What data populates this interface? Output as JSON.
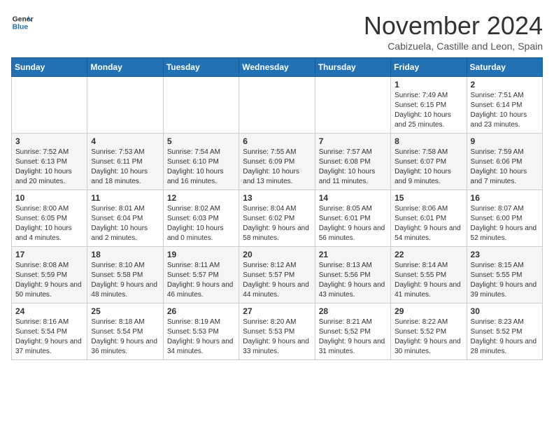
{
  "logo": {
    "general": "General",
    "blue": "Blue"
  },
  "header": {
    "month": "November 2024",
    "location": "Cabizuela, Castille and Leon, Spain"
  },
  "weekdays": [
    "Sunday",
    "Monday",
    "Tuesday",
    "Wednesday",
    "Thursday",
    "Friday",
    "Saturday"
  ],
  "weeks": [
    [
      {
        "day": "",
        "info": ""
      },
      {
        "day": "",
        "info": ""
      },
      {
        "day": "",
        "info": ""
      },
      {
        "day": "",
        "info": ""
      },
      {
        "day": "",
        "info": ""
      },
      {
        "day": "1",
        "info": "Sunrise: 7:49 AM\nSunset: 6:15 PM\nDaylight: 10 hours and 25 minutes."
      },
      {
        "day": "2",
        "info": "Sunrise: 7:51 AM\nSunset: 6:14 PM\nDaylight: 10 hours and 23 minutes."
      }
    ],
    [
      {
        "day": "3",
        "info": "Sunrise: 7:52 AM\nSunset: 6:13 PM\nDaylight: 10 hours and 20 minutes."
      },
      {
        "day": "4",
        "info": "Sunrise: 7:53 AM\nSunset: 6:11 PM\nDaylight: 10 hours and 18 minutes."
      },
      {
        "day": "5",
        "info": "Sunrise: 7:54 AM\nSunset: 6:10 PM\nDaylight: 10 hours and 16 minutes."
      },
      {
        "day": "6",
        "info": "Sunrise: 7:55 AM\nSunset: 6:09 PM\nDaylight: 10 hours and 13 minutes."
      },
      {
        "day": "7",
        "info": "Sunrise: 7:57 AM\nSunset: 6:08 PM\nDaylight: 10 hours and 11 minutes."
      },
      {
        "day": "8",
        "info": "Sunrise: 7:58 AM\nSunset: 6:07 PM\nDaylight: 10 hours and 9 minutes."
      },
      {
        "day": "9",
        "info": "Sunrise: 7:59 AM\nSunset: 6:06 PM\nDaylight: 10 hours and 7 minutes."
      }
    ],
    [
      {
        "day": "10",
        "info": "Sunrise: 8:00 AM\nSunset: 6:05 PM\nDaylight: 10 hours and 4 minutes."
      },
      {
        "day": "11",
        "info": "Sunrise: 8:01 AM\nSunset: 6:04 PM\nDaylight: 10 hours and 2 minutes."
      },
      {
        "day": "12",
        "info": "Sunrise: 8:02 AM\nSunset: 6:03 PM\nDaylight: 10 hours and 0 minutes."
      },
      {
        "day": "13",
        "info": "Sunrise: 8:04 AM\nSunset: 6:02 PM\nDaylight: 9 hours and 58 minutes."
      },
      {
        "day": "14",
        "info": "Sunrise: 8:05 AM\nSunset: 6:01 PM\nDaylight: 9 hours and 56 minutes."
      },
      {
        "day": "15",
        "info": "Sunrise: 8:06 AM\nSunset: 6:01 PM\nDaylight: 9 hours and 54 minutes."
      },
      {
        "day": "16",
        "info": "Sunrise: 8:07 AM\nSunset: 6:00 PM\nDaylight: 9 hours and 52 minutes."
      }
    ],
    [
      {
        "day": "17",
        "info": "Sunrise: 8:08 AM\nSunset: 5:59 PM\nDaylight: 9 hours and 50 minutes."
      },
      {
        "day": "18",
        "info": "Sunrise: 8:10 AM\nSunset: 5:58 PM\nDaylight: 9 hours and 48 minutes."
      },
      {
        "day": "19",
        "info": "Sunrise: 8:11 AM\nSunset: 5:57 PM\nDaylight: 9 hours and 46 minutes."
      },
      {
        "day": "20",
        "info": "Sunrise: 8:12 AM\nSunset: 5:57 PM\nDaylight: 9 hours and 44 minutes."
      },
      {
        "day": "21",
        "info": "Sunrise: 8:13 AM\nSunset: 5:56 PM\nDaylight: 9 hours and 43 minutes."
      },
      {
        "day": "22",
        "info": "Sunrise: 8:14 AM\nSunset: 5:55 PM\nDaylight: 9 hours and 41 minutes."
      },
      {
        "day": "23",
        "info": "Sunrise: 8:15 AM\nSunset: 5:55 PM\nDaylight: 9 hours and 39 minutes."
      }
    ],
    [
      {
        "day": "24",
        "info": "Sunrise: 8:16 AM\nSunset: 5:54 PM\nDaylight: 9 hours and 37 minutes."
      },
      {
        "day": "25",
        "info": "Sunrise: 8:18 AM\nSunset: 5:54 PM\nDaylight: 9 hours and 36 minutes."
      },
      {
        "day": "26",
        "info": "Sunrise: 8:19 AM\nSunset: 5:53 PM\nDaylight: 9 hours and 34 minutes."
      },
      {
        "day": "27",
        "info": "Sunrise: 8:20 AM\nSunset: 5:53 PM\nDaylight: 9 hours and 33 minutes."
      },
      {
        "day": "28",
        "info": "Sunrise: 8:21 AM\nSunset: 5:52 PM\nDaylight: 9 hours and 31 minutes."
      },
      {
        "day": "29",
        "info": "Sunrise: 8:22 AM\nSunset: 5:52 PM\nDaylight: 9 hours and 30 minutes."
      },
      {
        "day": "30",
        "info": "Sunrise: 8:23 AM\nSunset: 5:52 PM\nDaylight: 9 hours and 28 minutes."
      }
    ]
  ]
}
